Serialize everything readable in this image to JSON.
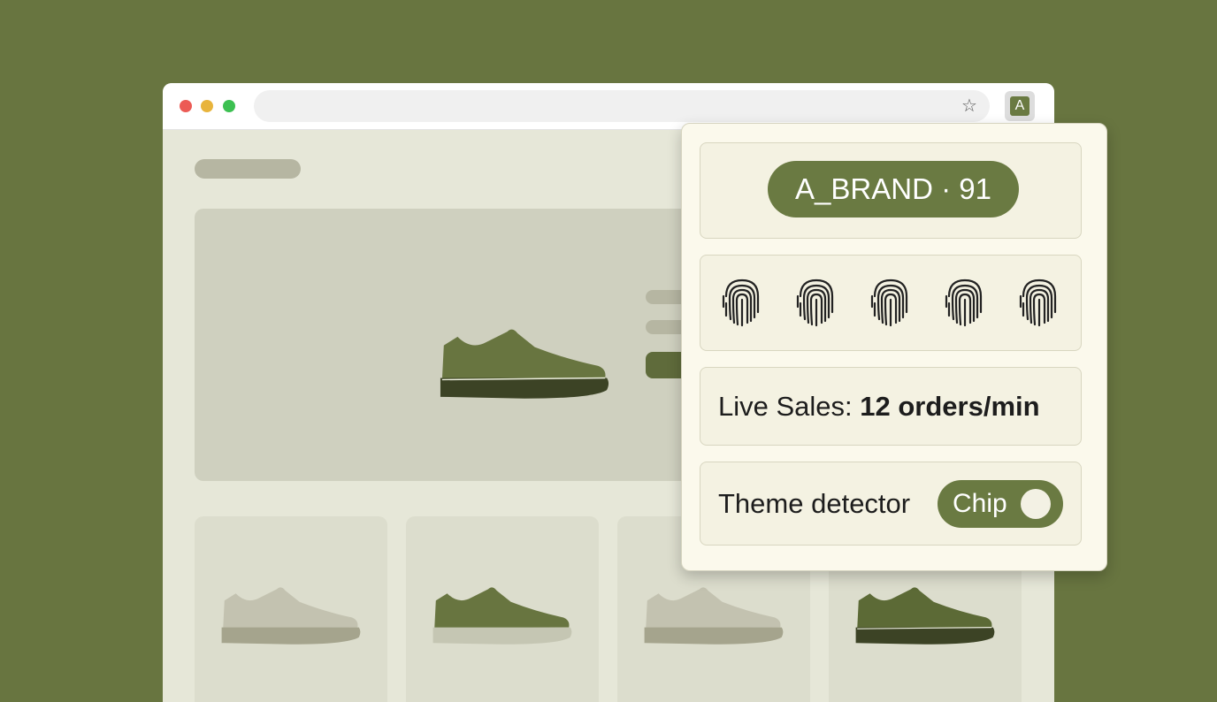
{
  "colors": {
    "background": "#687540",
    "accent": "#6a7a42",
    "popup": "#fbf9ec",
    "page": "#e6e7d8"
  },
  "browser": {
    "bookmark_icon": "star-icon",
    "extension_icon_letter": "A"
  },
  "popup": {
    "brand_badge": "A_BRAND · 91",
    "fingerprint_icons": [
      "fingerprint-icon",
      "fingerprint-icon",
      "fingerprint-icon",
      "fingerprint-icon",
      "fingerprint-icon"
    ],
    "live_sales_label": "Live Sales: ",
    "live_sales_value": "12 orders/min",
    "theme_detector_label": "Theme detector",
    "theme_toggle_label": "Chip",
    "theme_toggle_on": true
  }
}
